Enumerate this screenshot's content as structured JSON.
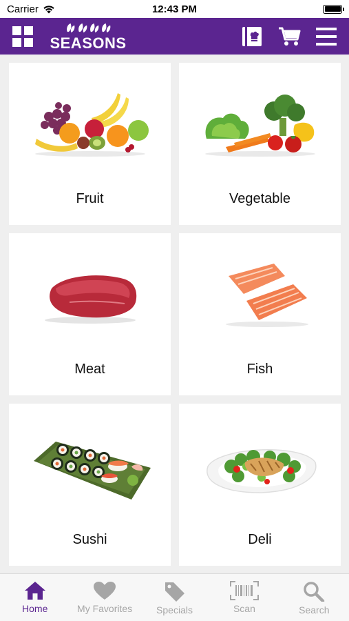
{
  "status_bar": {
    "carrier": "Carrier",
    "time": "12:43 PM",
    "battery_level": 1.0
  },
  "header": {
    "brand": "SEASONS",
    "brand_color": "#5b2590",
    "icons": [
      "grid-menu-icon",
      "recipe-book-icon",
      "shopping-cart-icon",
      "hamburger-menu-icon"
    ]
  },
  "categories": [
    {
      "label": "Fruit",
      "icon": "fruit-image"
    },
    {
      "label": "Vegetable",
      "icon": "vegetable-image"
    },
    {
      "label": "Meat",
      "icon": "meat-image"
    },
    {
      "label": "Fish",
      "icon": "fish-image"
    },
    {
      "label": "Sushi",
      "icon": "sushi-image"
    },
    {
      "label": "Deli",
      "icon": "deli-image"
    }
  ],
  "tab_bar": {
    "active_color": "#5b2590",
    "inactive_color": "#a6a6a6",
    "tabs": [
      {
        "label": "Home",
        "icon": "home-icon",
        "active": true
      },
      {
        "label": "My Favorites",
        "icon": "heart-icon",
        "active": false
      },
      {
        "label": "Specials",
        "icon": "tag-icon",
        "active": false
      },
      {
        "label": "Scan",
        "icon": "barcode-icon",
        "active": false
      },
      {
        "label": "Search",
        "icon": "search-icon",
        "active": false
      }
    ]
  }
}
